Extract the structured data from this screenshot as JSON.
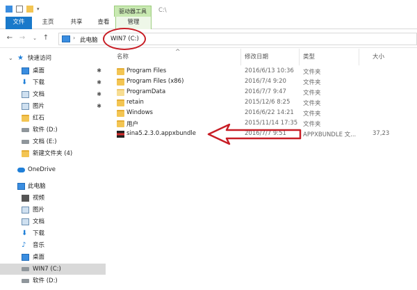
{
  "ribbon": {
    "context_group": "驱动器工具",
    "title_path": "C:\\",
    "tabs": [
      {
        "label": "文件"
      },
      {
        "label": "主页"
      },
      {
        "label": "共享"
      },
      {
        "label": "查看"
      },
      {
        "label": "管理"
      }
    ]
  },
  "address": {
    "crumbs": [
      "此电脑",
      "WIN7 (C:)"
    ]
  },
  "sidebar": {
    "quick_access": "快速访问",
    "items": [
      {
        "label": "桌面",
        "icon": "desktop-icon"
      },
      {
        "label": "下载",
        "icon": "download-icon"
      },
      {
        "label": "文档",
        "icon": "document-icon"
      },
      {
        "label": "图片",
        "icon": "pictures-icon"
      },
      {
        "label": "红石",
        "icon": "folder-icon"
      },
      {
        "label": "软件 (D:)",
        "icon": "drive-icon"
      },
      {
        "label": "文档 (E:)",
        "icon": "drive-icon"
      },
      {
        "label": "新建文件夹 (4)",
        "icon": "folder-icon"
      }
    ],
    "onedrive": "OneDrive",
    "this_pc": "此电脑",
    "pc_items": [
      {
        "label": "视频",
        "icon": "video-icon"
      },
      {
        "label": "图片",
        "icon": "pictures-icon"
      },
      {
        "label": "文档",
        "icon": "document-icon"
      },
      {
        "label": "下载",
        "icon": "download-icon"
      },
      {
        "label": "音乐",
        "icon": "music-icon"
      },
      {
        "label": "桌面",
        "icon": "desktop-icon"
      },
      {
        "label": "WIN7 (C:)",
        "icon": "drive-icon"
      },
      {
        "label": "软件 (D:)",
        "icon": "drive-icon"
      }
    ]
  },
  "columns": {
    "name": "名称",
    "modified": "修改日期",
    "type": "类型",
    "size": "大小"
  },
  "files": [
    {
      "name": "Program Files",
      "date": "2016/6/13 10:36",
      "type": "文件夹",
      "size": ""
    },
    {
      "name": "Program Files (x86)",
      "date": "2016/7/4 9:20",
      "type": "文件夹",
      "size": ""
    },
    {
      "name": "ProgramData",
      "date": "2016/7/7 9:47",
      "type": "文件夹",
      "size": ""
    },
    {
      "name": "retain",
      "date": "2015/12/6 8:25",
      "type": "文件夹",
      "size": ""
    },
    {
      "name": "Windows",
      "date": "2016/6/22 14:21",
      "type": "文件夹",
      "size": ""
    },
    {
      "name": "用户",
      "date": "2015/11/14 17:35",
      "type": "文件夹",
      "size": ""
    },
    {
      "name": "sina5.2.3.0.appxbundle",
      "date": "2016/7/7 9:51",
      "type": "APPXBUNDLE 文...",
      "size": "37,23"
    }
  ],
  "colors": {
    "accent": "#1979ca",
    "context_tab": "#c8e9b1",
    "annotation_red": "#c81d25",
    "folder": "#f3c553"
  }
}
